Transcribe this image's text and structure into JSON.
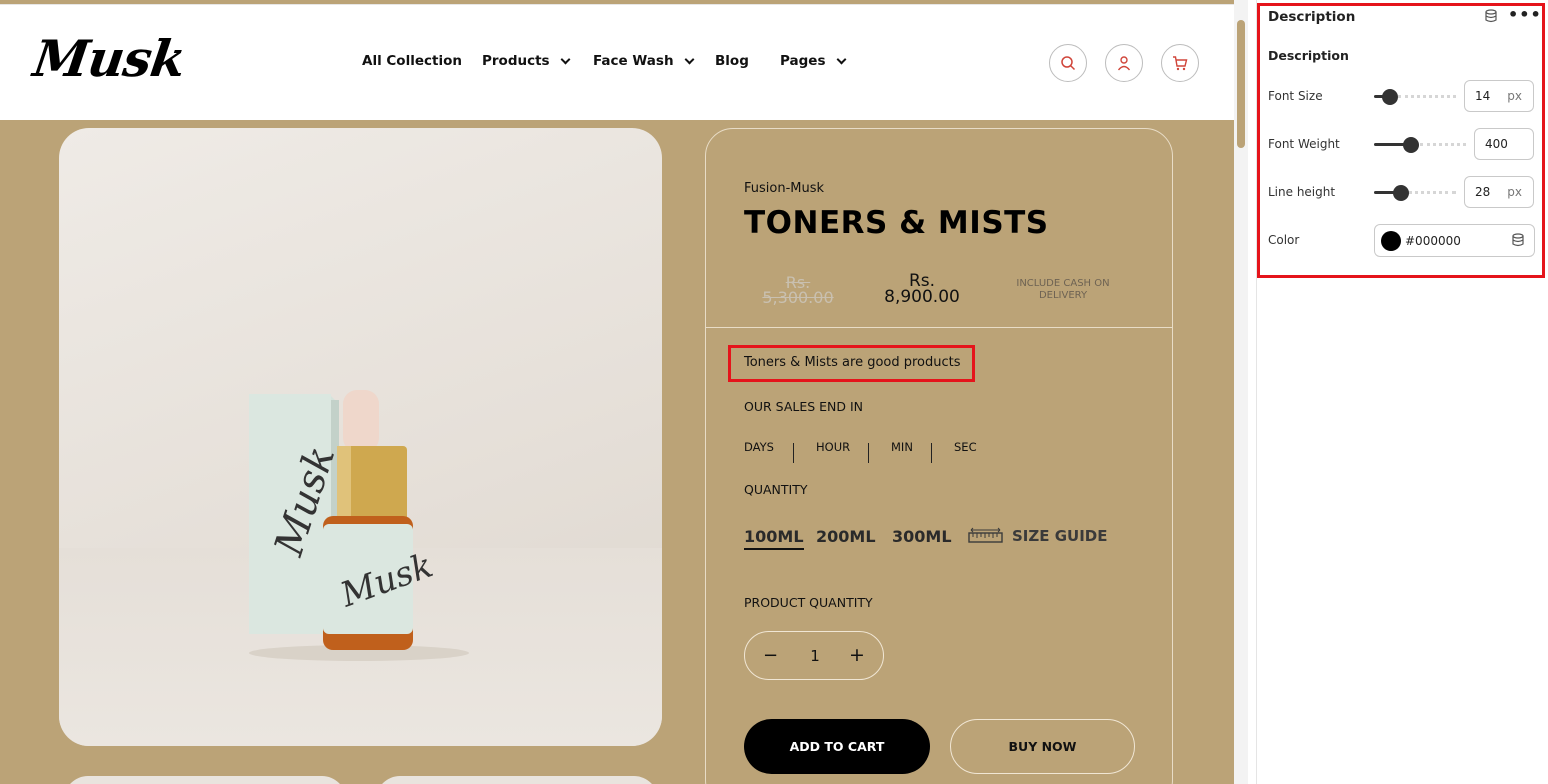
{
  "site": {
    "logo": "Musk",
    "nav": [
      {
        "label": "All Collection",
        "dropdown": false
      },
      {
        "label": "Products",
        "dropdown": true
      },
      {
        "label": "Face Wash",
        "dropdown": true
      },
      {
        "label": "Blog",
        "dropdown": false
      },
      {
        "label": "Pages",
        "dropdown": true
      }
    ],
    "header_icons": [
      "search-icon",
      "user-icon",
      "cart-icon"
    ],
    "accent_color": "#e5141b",
    "background_color": "#bba377"
  },
  "product": {
    "brand": "Fusion-Musk",
    "title": "TONERS & MISTS",
    "old_price_currency": "Rs.",
    "old_price": "5,300.00",
    "new_price_currency": "Rs.",
    "new_price": "8,900.00",
    "cod_note": "INCLUDE CASH ON DELIVERY",
    "description": "Toners & Mists are good products",
    "sales_label": "OUR SALES END IN",
    "countdown": [
      "DAYS",
      "HOUR",
      "MIN",
      "SEC"
    ],
    "quantity_label": "QUANTITY",
    "sizes": [
      "100ML",
      "200ML",
      "300ML"
    ],
    "selected_size": "100ML",
    "size_guide": "SIZE GUIDE",
    "product_quantity_label": "PRODUCT QUANTITY",
    "quantity": "1",
    "add_to_cart": "ADD TO CART",
    "buy_now": "BUY NOW",
    "image_label_bottle": "Musk",
    "image_label_box": "Musk"
  },
  "panel": {
    "title": "Description",
    "section": "Description",
    "font_size": {
      "label": "Font Size",
      "value": "14",
      "unit": "px",
      "slider_fraction": 0.17
    },
    "font_weight": {
      "label": "Font Weight",
      "value": "400",
      "slider_fraction": 0.39
    },
    "line_height": {
      "label": "Line height",
      "value": "28",
      "unit": "px",
      "slider_fraction": 0.33
    },
    "color": {
      "label": "Color",
      "value": "#000000"
    }
  }
}
